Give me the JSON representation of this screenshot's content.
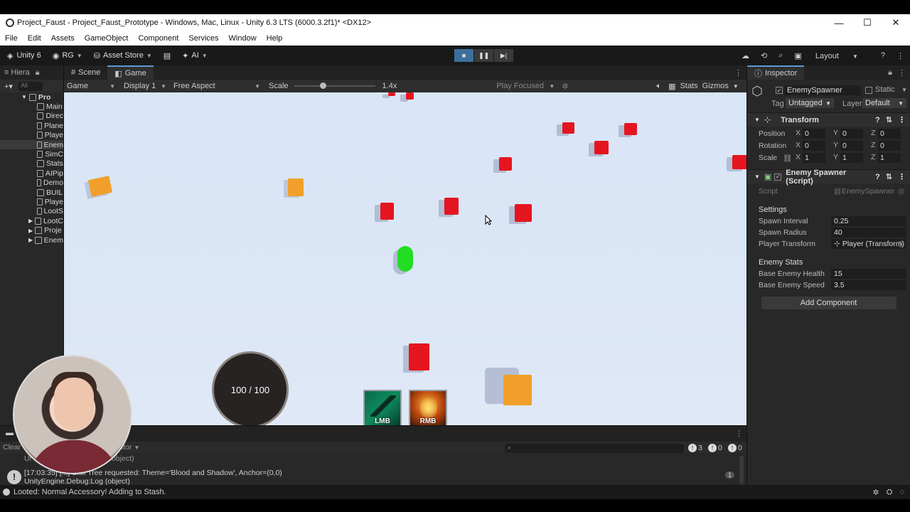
{
  "window": {
    "title": "Project_Faust - Project_Faust_Prototype - Windows, Mac, Linux - Unity 6.3 LTS (6000.3.2f1)* <DX12>",
    "minimize": "—",
    "maximize": "☐",
    "close": "✕"
  },
  "menu": [
    "File",
    "Edit",
    "Assets",
    "GameObject",
    "Component",
    "Services",
    "Window",
    "Help"
  ],
  "toolbar": {
    "unity_label": "Unity 6",
    "account": "RG",
    "asset_store": "Asset Store",
    "ai": "AI",
    "layout": "Layout"
  },
  "hierarchy": {
    "tab": "Hiera",
    "search_placeholder": "All",
    "root": "Pro",
    "items": [
      "Main",
      "Direc",
      "Plane",
      "Playe",
      "Enem",
      "SimC",
      "Stats",
      "AIPip",
      "Demo",
      "BUIL",
      "Playe",
      "LootS",
      "LootC",
      "Proje",
      "Enem"
    ]
  },
  "view_tabs": {
    "scene": "Scene",
    "game": "Game"
  },
  "gamebar": {
    "mode": "Game",
    "display": "Display 1",
    "aspect": "Free Aspect",
    "scale_label": "Scale",
    "scale_value": "1.4x",
    "play_focused": "Play Focused",
    "stats": "Stats",
    "gizmos": "Gizmos"
  },
  "game_hud": {
    "health_text": "100 / 100",
    "skill_left": "LMB",
    "skill_right": "RMB",
    "health_current": 100,
    "health_max": 100
  },
  "inspector": {
    "tab": "Inspector",
    "object_name": "EnemySpawner",
    "static_label": "Static",
    "tag_label": "Tag",
    "tag_value": "Untagged",
    "layer_label": "Layer",
    "layer_value": "Default",
    "transform": {
      "title": "Transform",
      "position_label": "Position",
      "rotation_label": "Rotation",
      "scale_label": "Scale",
      "position": [
        "0",
        "0",
        "0"
      ],
      "rotation": [
        "0",
        "0",
        "0"
      ],
      "scale": [
        "1",
        "1",
        "1"
      ]
    },
    "script_component": {
      "title": "Enemy Spawner (Script)",
      "script_label": "Script",
      "script_value": "EnemySpawner",
      "settings_header": "Settings",
      "spawn_interval_label": "Spawn Interval",
      "spawn_interval": "0.25",
      "spawn_radius_label": "Spawn Radius",
      "spawn_radius": "40",
      "player_transform_label": "Player Transform",
      "player_transform": "Player (Transform)",
      "enemy_stats_header": "Enemy Stats",
      "base_health_label": "Base Enemy Health",
      "base_health": "15",
      "base_speed_label": "Base Enemy Speed",
      "base_speed": "3.5"
    },
    "add_component": "Add Component"
  },
  "console": {
    "clear": "Clear",
    "editor": "ditor",
    "counts": {
      "logs": "3",
      "warnings": "0",
      "errors": "0"
    },
    "log1_prefix": "Ur",
    "log1_suffix": "object)",
    "log2_line1": "[17:03:35] [...] Skill Tree requested: Theme='Blood and Shadow', Anchor=(0,0)",
    "log2_line2": "UnityEngine.Debug:Log (object)",
    "log2_count": "1"
  },
  "status": {
    "message": "Looted: Normal Accessory! Adding to Stash."
  },
  "colors": {
    "enemy": "#e51520",
    "loot": "#f0a02a",
    "player": "#22dd22",
    "accent": "#5a9bd5"
  }
}
